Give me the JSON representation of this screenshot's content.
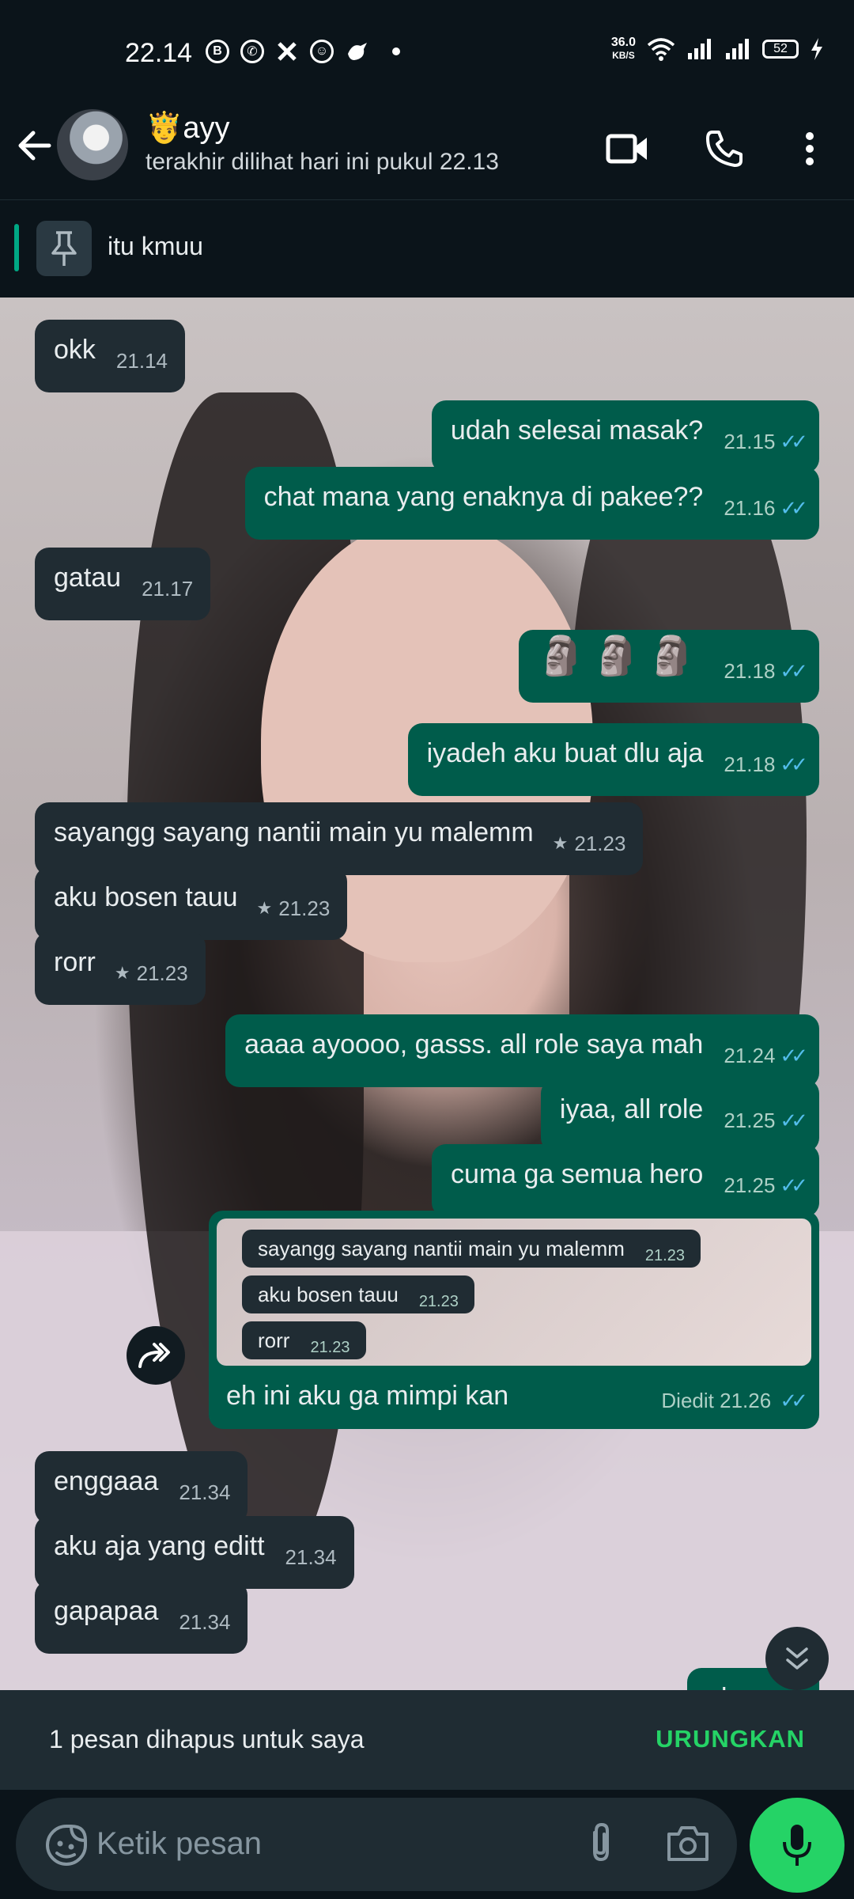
{
  "status_bar": {
    "time": "22.14",
    "speed_value": "36.0",
    "speed_unit": "KB/S",
    "battery": "52",
    "app_icons": [
      "b-icon",
      "whatsapp-icon",
      "x-icon",
      "smiley-icon",
      "bird-icon"
    ]
  },
  "header": {
    "contact_emoji": "🤴",
    "contact_name": "ayy",
    "status": "terakhir dilihat hari ini pukul 22.13"
  },
  "pinned": {
    "text": "itu kmuu"
  },
  "messages": [
    {
      "dir": "in",
      "text": "okk",
      "time": "21.14"
    },
    {
      "dir": "out",
      "text": "udah selesai masak?",
      "time": "21.15"
    },
    {
      "dir": "out",
      "text": "chat mana yang enaknya di pakee??",
      "time": "21.16"
    },
    {
      "dir": "in",
      "text": "gatau",
      "time": "21.17"
    },
    {
      "dir": "out",
      "text": "🗿🗿🗿",
      "time": "21.18"
    },
    {
      "dir": "out",
      "text": "iyadeh aku buat dlu aja",
      "time": "21.18"
    },
    {
      "dir": "in",
      "text": "sayangg sayang nantii main yu malemm",
      "time": "21.23",
      "starred": true
    },
    {
      "dir": "in",
      "text": "aku bosen tauu",
      "time": "21.23",
      "starred": true
    },
    {
      "dir": "in",
      "text": "rorr",
      "time": "21.23",
      "starred": true
    },
    {
      "dir": "out",
      "text": "aaaa ayoooo, gasss. all role saya mah",
      "time": "21.24"
    },
    {
      "dir": "out",
      "text": "iyaa, all role",
      "time": "21.25"
    },
    {
      "dir": "out",
      "text": "cuma ga semua hero",
      "time": "21.25"
    },
    {
      "dir": "out",
      "text": "eh ini aku ga mimpi kan",
      "time": "21.26",
      "edited_label": "Diedit",
      "quoted": [
        {
          "text": "sayangg sayang nantii main yu malemm",
          "time": "21.23"
        },
        {
          "text": "aku bosen tauu",
          "time": "21.23"
        },
        {
          "text": "rorr",
          "time": "21.23"
        }
      ]
    },
    {
      "dir": "in",
      "text": "enggaaa",
      "time": "21.34"
    },
    {
      "dir": "in",
      "text": "aku aja yang editt",
      "time": "21.34"
    },
    {
      "dir": "in",
      "text": "gapapaa",
      "time": "21.34"
    },
    {
      "dir": "out",
      "text": "eh ayoo",
      "time": ""
    }
  ],
  "snackbar": {
    "text": "1 pesan dihapus untuk saya",
    "action": "URUNGKAN"
  },
  "input": {
    "placeholder": "Ketik pesan"
  },
  "colors": {
    "outgoing_bubble": "#005c4b",
    "incoming_bubble": "#202c33",
    "read_ticks": "#53bdeb",
    "accent": "#25d366"
  }
}
